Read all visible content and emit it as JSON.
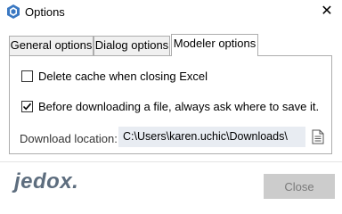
{
  "window": {
    "title": "Options",
    "close_glyph": "✕",
    "icon": "jedox-cube-icon"
  },
  "tabs": [
    {
      "label": "General options",
      "active": false
    },
    {
      "label": "Dialog options",
      "active": false
    },
    {
      "label": "Modeler options",
      "active": true
    }
  ],
  "options": {
    "delete_cache": {
      "label": "Delete cache when closing Excel",
      "checked": false
    },
    "ask_download_location": {
      "label": "Before downloading a file, always ask where to save it.",
      "checked": true
    }
  },
  "download": {
    "label": "Download location:",
    "value": "C:\\Users\\karen.uchic\\Downloads\\",
    "browse_icon": "document-browse-icon"
  },
  "footer": {
    "logo_text": "jedox.",
    "close_label": "Close"
  },
  "colors": {
    "field_bg": "#e8ecf2",
    "button_bg": "#cccccc",
    "logo": "#5d6d7e",
    "app_icon_accent": "#3a78c2"
  }
}
